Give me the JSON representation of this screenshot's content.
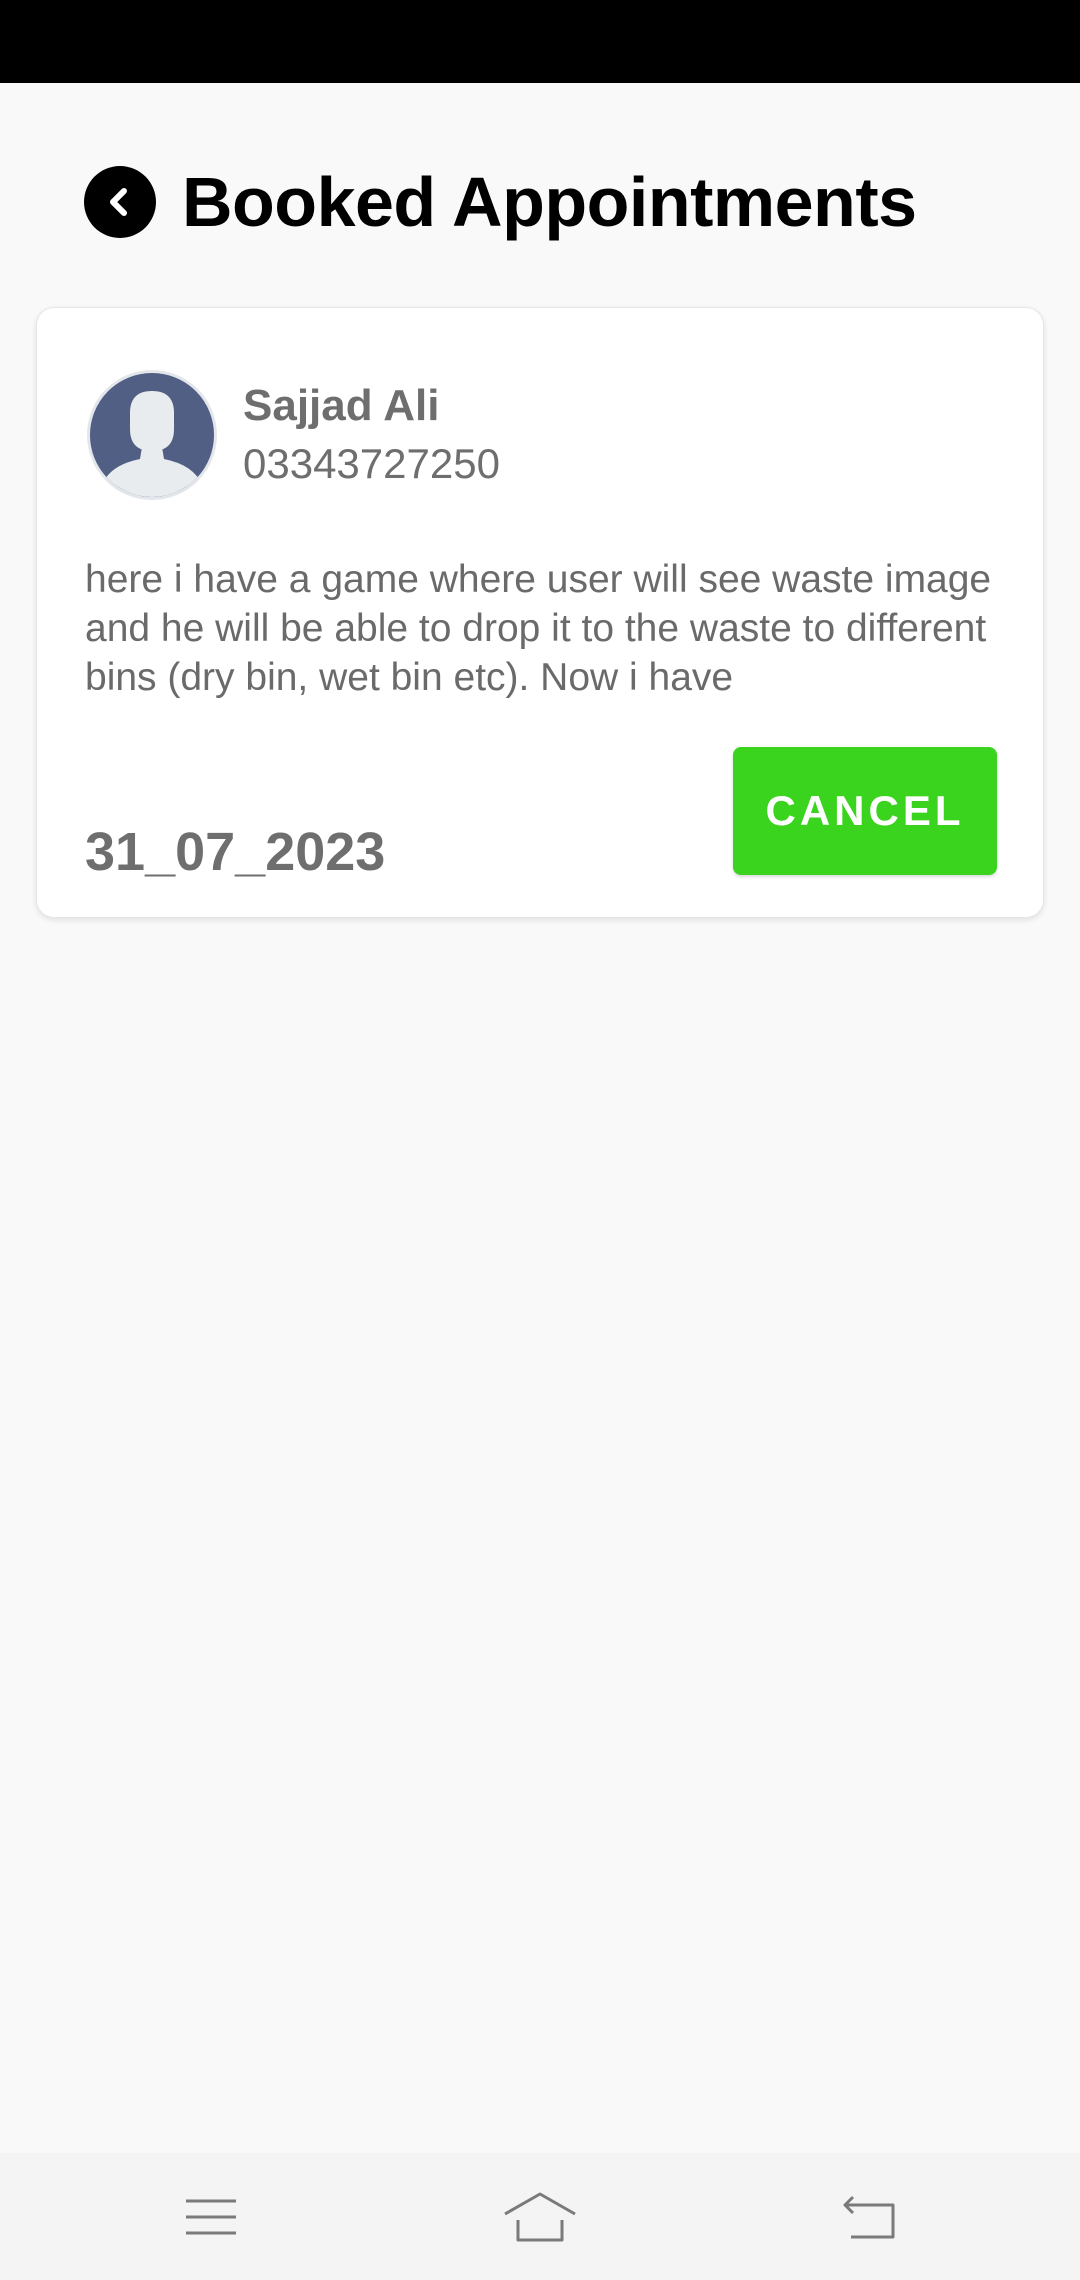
{
  "header": {
    "title": "Booked Appointments",
    "back_icon": "chevron-left-icon"
  },
  "appointment": {
    "name": "Sajjad Ali",
    "phone": "03343727250",
    "description": "here i have a game where user will see waste image and he will be able to drop it to the waste to different bins (dry bin, wet bin etc). Now i have",
    "date": "31_07_2023",
    "cancel_label": "CANCEL",
    "avatar_icon": "default-user-avatar-icon"
  },
  "nav": {
    "menu_icon": "menu-icon",
    "home_icon": "home-icon",
    "back_icon": "back-icon"
  },
  "colors": {
    "accent": "#3ad31d",
    "avatar_bg": "#515f85",
    "status_bar": "#000000"
  }
}
